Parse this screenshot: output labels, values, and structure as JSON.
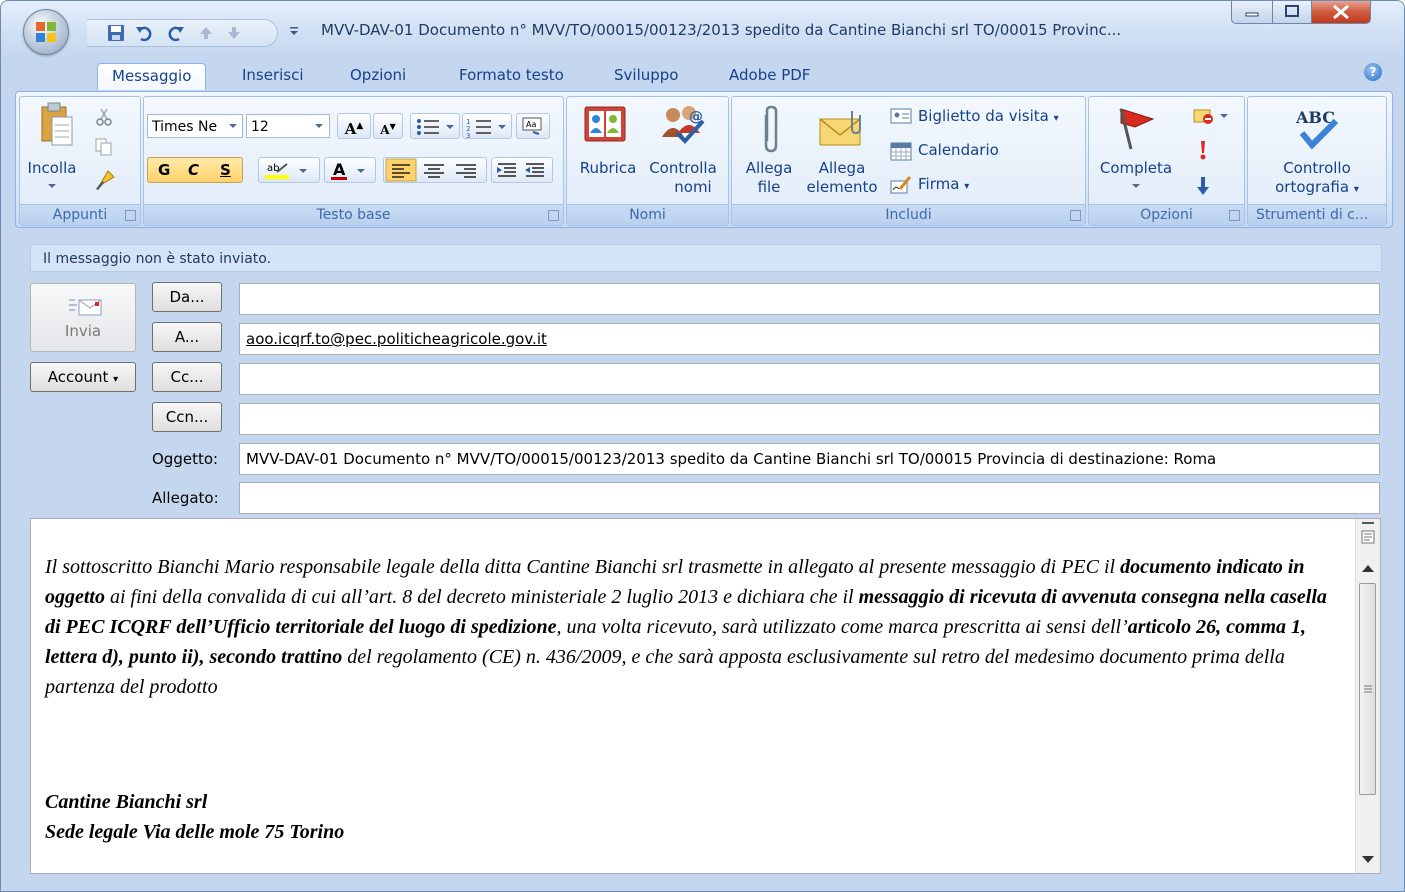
{
  "window": {
    "title": "MVV-DAV-01  Documento n° MVV/TO/00015/00123/2013  spedito da Cantine Bianchi srl  TO/00015 Provinc..."
  },
  "tabs": [
    "Messaggio",
    "Inserisci",
    "Opzioni",
    "Formato testo",
    "Sviluppo",
    "Adobe PDF"
  ],
  "active_tab": "Messaggio",
  "ribbon": {
    "appunti": {
      "label": "Appunti",
      "paste": "Incolla"
    },
    "testo_base": {
      "label": "Testo base",
      "font": "Times Ne",
      "size": "12",
      "bold": "G",
      "italic": "C",
      "underline": "S",
      "grow": "A",
      "shrink": "A"
    },
    "nomi": {
      "label": "Nomi",
      "rubrica": "Rubrica",
      "controlla1": "Controlla",
      "controlla2": "nomi"
    },
    "includi": {
      "label": "Includi",
      "allega_file1": "Allega",
      "allega_file2": "file",
      "allega_elem1": "Allega",
      "allega_elem2": "elemento",
      "biglietto": "Biglietto da visita",
      "calendario": "Calendario",
      "firma": "Firma"
    },
    "opzioni": {
      "label": "Opzioni",
      "completa": "Completa"
    },
    "strumenti": {
      "label": "Strumenti di c...",
      "controllo1": "Controllo",
      "controllo2": "ortografia"
    }
  },
  "message": {
    "info": "Il messaggio non è stato inviato.",
    "send": "Invia",
    "account": "Account",
    "da_btn": "Da...",
    "a_btn": "A...",
    "cc_btn": "Cc...",
    "ccn_btn": "Ccn...",
    "da_value": "",
    "a_value": "aoo.icqrf.to@pec.politicheagricole.gov.it",
    "cc_value": "",
    "ccn_value": "",
    "oggetto_label": "Oggetto:",
    "oggetto_value": "MVV-DAV-01  Documento n° MVV/TO/00015/00123/2013  spedito da Cantine Bianchi srl  TO/00015 Provincia di destinazione: Roma",
    "allegato_label": "Allegato:",
    "allegato_value": ""
  },
  "body": {
    "p1": "Il sottoscritto Bianchi Mario  responsabile legale della ditta Cantine Bianchi srl trasmette in allegato al presente messaggio di PEC il ",
    "p1_b": "documento indicato in oggetto",
    "p2": " ai fini della convalida di cui all’art. 8 del decreto ministeriale 2 luglio 2013 e dichiara che il ",
    "p2_b": "messaggio di ricevuta di avvenuta consegna nella casella di PEC ICQRF dell’Ufficio territoriale del luogo di spedizione",
    "p3": ", una volta ricevuto, sarà utilizzato come marca prescritta ai sensi dell’",
    "p3_b": "articolo 26, comma 1, lettera d), punto ii), secondo trattino",
    "p4": " del regolamento (CE) n. 436/2009, e che sarà apposta esclusivamente sul retro del medesimo documento prima della partenza del prodotto",
    "sign1": "Cantine Bianchi srl",
    "sign2": "Sede legale Via delle mole 75 Torino"
  }
}
